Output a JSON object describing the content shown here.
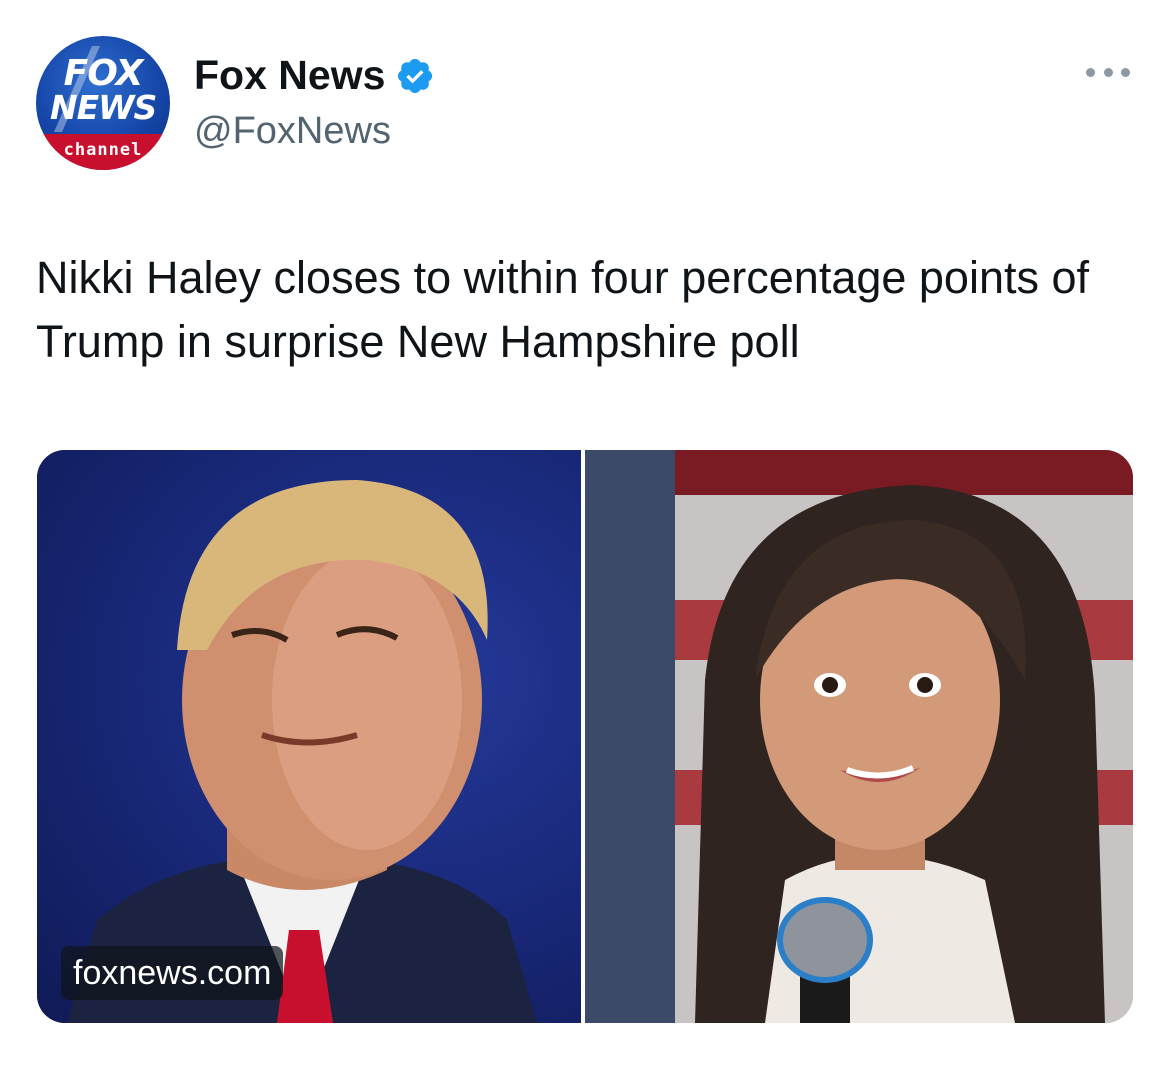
{
  "account": {
    "display_name": "Fox News",
    "handle": "@FoxNews",
    "verified": true,
    "avatar": {
      "logo_line1": "FOX",
      "logo_line2": "NEWS",
      "logo_line3": "channel",
      "icon": "fox-news-channel-logo"
    }
  },
  "menu": {
    "icon": "more-horizontal-icon"
  },
  "tweet": {
    "text": "Nikki Haley closes to within four percentage points of Trump in surprise New Hampshire poll"
  },
  "media": {
    "source_label": "foxnews.com",
    "colors": {
      "left_background": "#1a2a7d",
      "right_background": "#b8b4b4"
    }
  },
  "colors": {
    "text": "#0f1419",
    "secondary_text": "#536471",
    "verified_badge": "#1d9bf0",
    "logo_blue": "#1546a8",
    "logo_red": "#c8102e"
  }
}
